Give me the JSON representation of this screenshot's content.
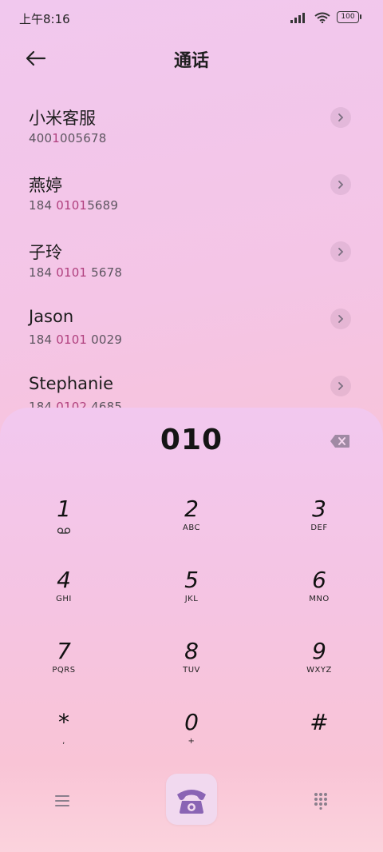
{
  "status": {
    "time": "上午8:16",
    "battery": "100"
  },
  "header": {
    "title": "通话"
  },
  "results": [
    {
      "name": "小米客服",
      "number_parts": [
        "400",
        "1",
        "00",
        "5678"
      ],
      "hl": [
        false,
        true,
        false,
        false
      ]
    },
    {
      "name": "燕婷",
      "number_parts": [
        "184 ",
        "0101",
        "5689"
      ],
      "hl": [
        false,
        true,
        false
      ]
    },
    {
      "name": "子玲",
      "number_parts": [
        "184 ",
        "0101",
        " 5678"
      ],
      "hl": [
        false,
        true,
        false
      ]
    },
    {
      "name": "Jason",
      "number_parts": [
        "184 ",
        "0101",
        " 0029"
      ],
      "hl": [
        false,
        true,
        false
      ]
    },
    {
      "name": "Stephanie",
      "number_parts": [
        "184 ",
        "0102",
        " 4685"
      ],
      "hl": [
        false,
        true,
        false
      ]
    }
  ],
  "dialpad": {
    "input": "010",
    "keys": [
      {
        "digit": "1",
        "letters": ""
      },
      {
        "digit": "2",
        "letters": "ABC"
      },
      {
        "digit": "3",
        "letters": "DEF"
      },
      {
        "digit": "4",
        "letters": "GHI"
      },
      {
        "digit": "5",
        "letters": "JKL"
      },
      {
        "digit": "6",
        "letters": "MNO"
      },
      {
        "digit": "7",
        "letters": "PQRS"
      },
      {
        "digit": "8",
        "letters": "TUV"
      },
      {
        "digit": "9",
        "letters": "WXYZ"
      },
      {
        "digit": "*",
        "letters": ","
      },
      {
        "digit": "0",
        "letters": "+"
      },
      {
        "digit": "#",
        "letters": ""
      }
    ]
  },
  "colors": {
    "highlight": "#b0407e",
    "call_icon": "#8a64b4"
  },
  "icons": [
    "back-arrow-icon",
    "chevron-right-icon",
    "backspace-icon",
    "voicemail-icon",
    "menu-icon",
    "phone-icon",
    "keypad-icon",
    "signal-icon",
    "wifi-icon",
    "battery-icon"
  ]
}
